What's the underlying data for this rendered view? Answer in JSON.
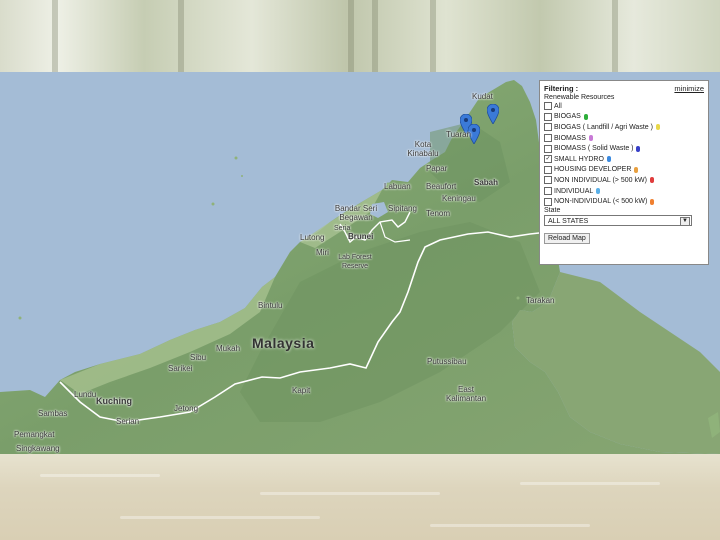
{
  "panel": {
    "title": "Filtering :",
    "minimize": "minimize",
    "subtitle": "Renewable Resources",
    "options": [
      {
        "label": "All",
        "checked": false,
        "marker": ""
      },
      {
        "label": "BIOGAS",
        "checked": false,
        "marker": "#2eae3a"
      },
      {
        "label": "BIOGAS ( Landfill / Agri Waste )",
        "checked": false,
        "marker": "#e8d84a"
      },
      {
        "label": "BIOMASS",
        "checked": false,
        "marker": "#c87ad6"
      },
      {
        "label": "BIOMASS ( Solid Waste )",
        "checked": false,
        "marker": "#3840c8"
      },
      {
        "label": "SMALL HYDRO",
        "checked": true,
        "marker": "#3a8ae0"
      },
      {
        "label": "HOUSING DEVELOPER",
        "checked": false,
        "marker": "#e8a040"
      },
      {
        "label": "NON INDIVIDUAL (> 500 kW)",
        "checked": false,
        "marker": "#e03c3c"
      },
      {
        "label": "INDIVIDUAL",
        "checked": false,
        "marker": "#5ab0e8"
      },
      {
        "label": "NON-INDIVIDUAL (< 500 kW)",
        "checked": false,
        "marker": "#f08030"
      }
    ],
    "state_label": "State",
    "state_value": "ALL STATES",
    "button": "Reload Map"
  },
  "map": {
    "country": "Malaysia",
    "places": {
      "kudat": "Kudat",
      "tuaran": "Tuaran",
      "kota_kinabalu": "Kota Kinabalu",
      "papar": "Papar",
      "beaufort": "Beaufort",
      "labuan": "Labuan",
      "sabah": "Sabah",
      "keningau": "Keningau",
      "tenom": "Tenom",
      "sipitang": "Sipitang",
      "bandar_seri_begawan": "Bandar Seri Begawan",
      "seria": "Seria",
      "lutong": "Lutong",
      "brunei": "Brunei",
      "miri": "Miri",
      "lab_forest": "Lab Forest Reserve",
      "bintulu": "Bintulu",
      "mukah": "Mukah",
      "sibu": "Sibu",
      "sarikei": "Sarikei",
      "kapit": "Kapit",
      "kuching": "Kuching",
      "jetong": "Jetong",
      "serian": "Serian",
      "sambas": "Sambas",
      "pemangkat": "Pemangkat",
      "singkawang": "Singkawang",
      "tanjung": "Tanjung",
      "putussibau": "Putussibau",
      "kalimantan": "East Kalimantan",
      "tarakan": "Tarakan",
      "lundu": "Lundu"
    }
  }
}
